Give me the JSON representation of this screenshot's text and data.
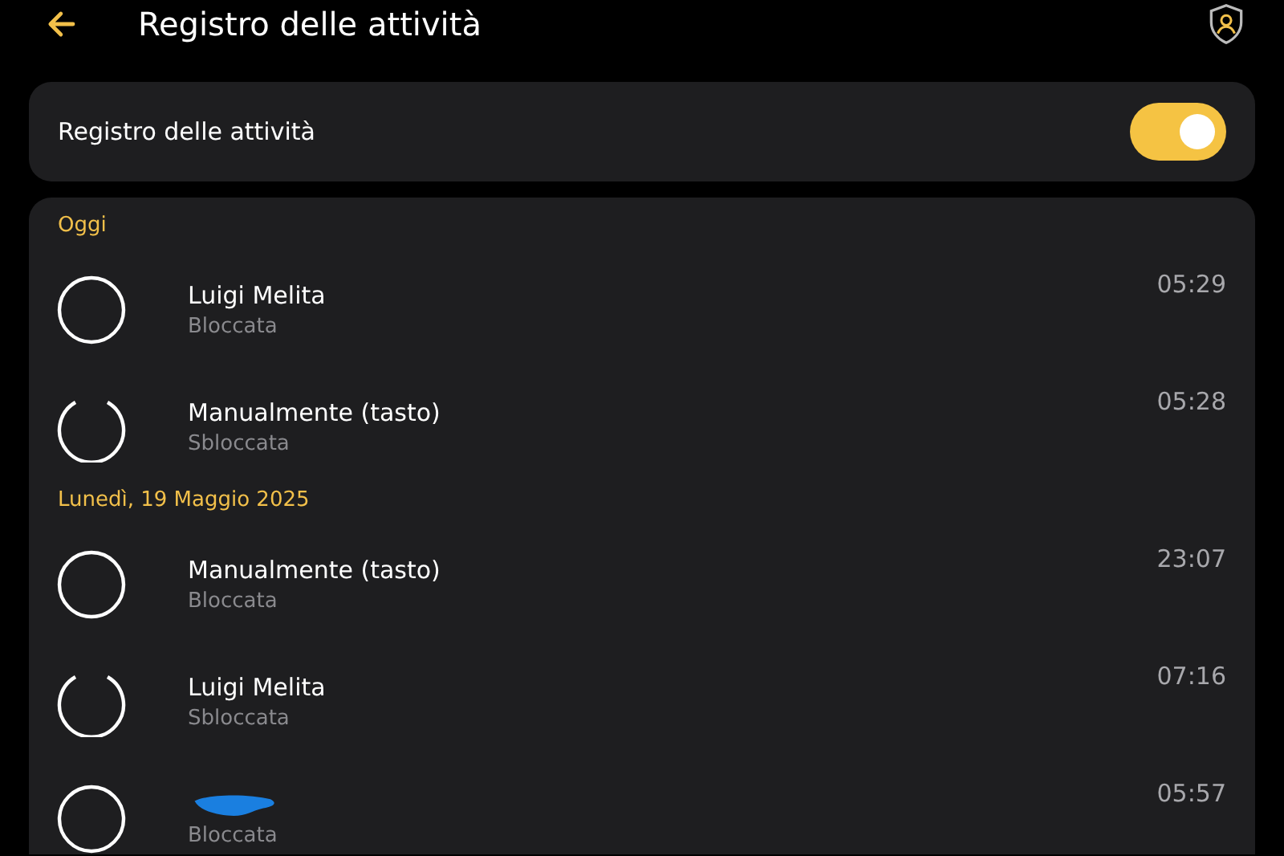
{
  "header": {
    "title": "Registro delle attività"
  },
  "setting": {
    "label": "Registro delle attività",
    "on": true
  },
  "sections": [
    {
      "heading": "Oggi",
      "entries": [
        {
          "kind": "locked",
          "name": "Luigi Melita",
          "status": "Bloccata",
          "time": "05:29"
        },
        {
          "kind": "unlocked",
          "name": "Manualmente (tasto)",
          "status": "Sbloccata",
          "time": "05:28"
        }
      ]
    },
    {
      "heading": "Lunedì, 19 Maggio 2025",
      "entries": [
        {
          "kind": "locked",
          "name": "Manualmente (tasto)",
          "status": "Bloccata",
          "time": "23:07"
        },
        {
          "kind": "unlocked",
          "name": "Luigi Melita",
          "status": "Sbloccata",
          "time": "07:16"
        },
        {
          "kind": "locked",
          "redacted": true,
          "status": "Bloccata",
          "time": "05:57"
        }
      ]
    }
  ]
}
